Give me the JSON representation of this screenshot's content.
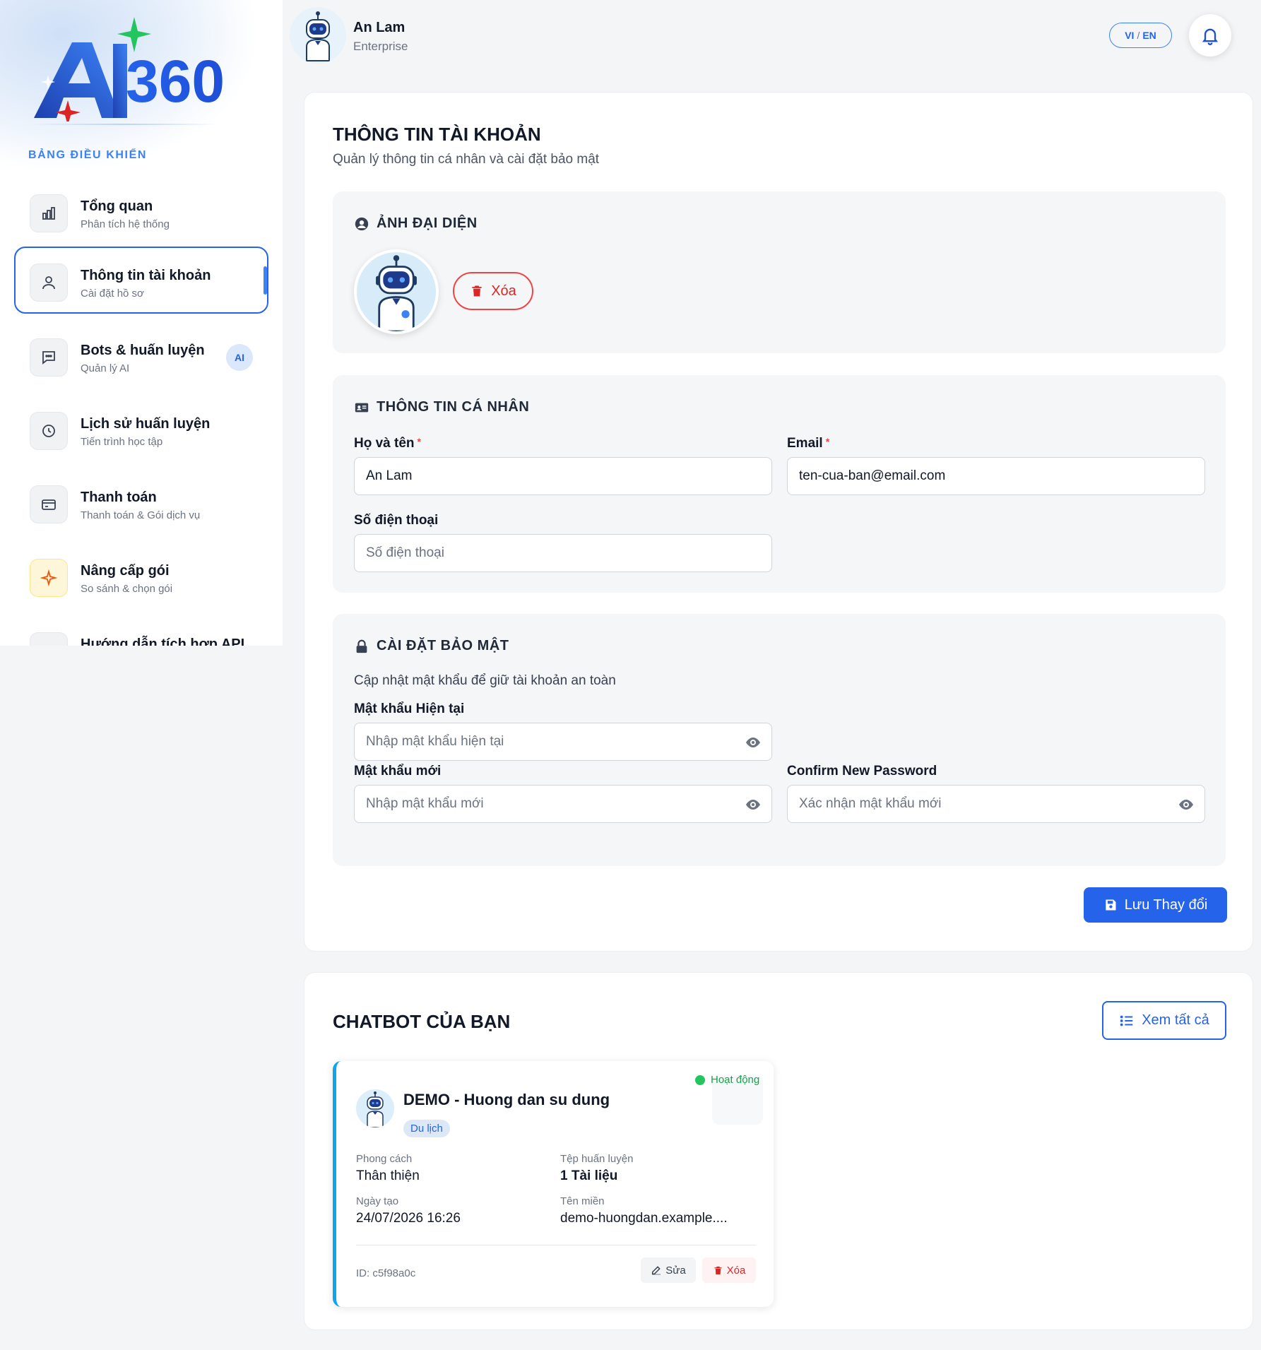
{
  "colors": {
    "primary": "#2563eb",
    "danger": "#dc2626",
    "success": "#22c55e",
    "accent_bar": "#0ea5e9"
  },
  "sidebar": {
    "section_label": "BẢNG ĐIỀU KHIỂN",
    "items": [
      {
        "title": "Tổng quan",
        "subtitle": "Phân tích hệ thống",
        "icon": "chart-bar-icon"
      },
      {
        "title": "Thông tin tài khoản",
        "subtitle": "Cài đặt hồ sơ",
        "icon": "user-icon",
        "active": true
      },
      {
        "title": "Bots & huấn luyện",
        "subtitle": "Quản lý AI",
        "icon": "chat-icon",
        "badge": "AI"
      },
      {
        "title": "Lịch sử huấn luyện",
        "subtitle": "Tiến trình học tập",
        "icon": "clock-icon"
      },
      {
        "title": "Thanh toán",
        "subtitle": "Thanh toán & Gói dịch vụ",
        "icon": "credit-card-icon"
      },
      {
        "title": "Nâng cấp gói",
        "subtitle": "So sánh & chọn gói",
        "icon": "sparkle-icon"
      },
      {
        "title": "Hướng dẫn tích hợp API",
        "subtitle": "",
        "icon": "code-icon"
      }
    ]
  },
  "header": {
    "user_name": "An Lam",
    "plan": "Enterprise",
    "lang_vi": "VI",
    "lang_sep": "/",
    "lang_en": "EN"
  },
  "account": {
    "title": "THÔNG TIN TÀI KHOẢN",
    "subtitle": "Quản lý thông tin cá nhân và cài đặt bảo mật",
    "avatar_section": {
      "title": "ẢNH ĐẠI DIỆN",
      "delete_label": "Xóa"
    },
    "personal": {
      "title": "THÔNG TIN CÁ NHÂN",
      "fullname_label": "Họ và tên",
      "fullname_value": "An Lam",
      "email_label": "Email",
      "email_value": "ten-cua-ban@email.com",
      "phone_label": "Số điện thoại",
      "phone_placeholder": "Số điện thoại",
      "required_mark": "*"
    },
    "security": {
      "title": "CÀI ĐẶT BẢO MẬT",
      "description": "Cập nhật mật khẩu để giữ tài khoản an toàn",
      "current_label": "Mật khẩu Hiện tại",
      "current_placeholder": "Nhập mật khẩu hiện tại",
      "new_label": "Mật khẩu mới",
      "new_placeholder": "Nhập mật khẩu mới",
      "confirm_label": "Confirm New Password",
      "confirm_placeholder": "Xác nhận mật khẩu mới"
    },
    "save_label": "Lưu Thay đổi"
  },
  "chatbots": {
    "title": "CHATBOT CỦA BẠN",
    "view_all_label": "Xem tất cả",
    "items": [
      {
        "name": "DEMO - Huong dan su dung",
        "category": "Du lịch",
        "status": "Hoạt động",
        "style_label": "Phong cách",
        "style_value": "Thân thiện",
        "files_label": "Tệp huấn luyện",
        "files_value": "1 Tài liệu",
        "created_label": "Ngày tạo",
        "created_value": "24/07/2026 16:26",
        "domain_label": "Tên miền",
        "domain_value": "demo-huongdan.example....",
        "id_text": "ID: c5f98a0c",
        "edit_label": "Sửa",
        "delete_label": "Xóa"
      }
    ]
  }
}
